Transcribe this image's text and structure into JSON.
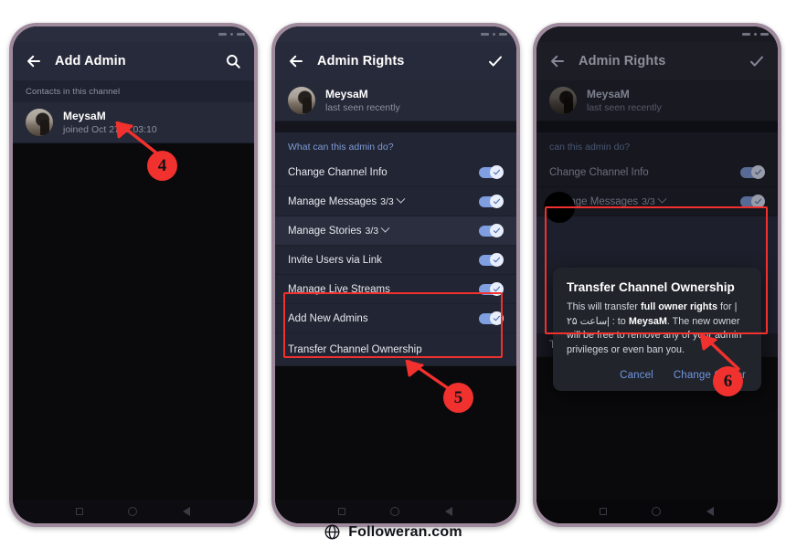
{
  "watermark": {
    "text": "Followeran.com",
    "icon": "globe-icon"
  },
  "colors": {
    "accent_red": "#f1312e",
    "toggle_on": "#7f9fe0",
    "link_blue": "#6f96e0",
    "section_blue": "#7f9cd8",
    "appbar_bg": "#272a3a",
    "list_bg": "#222533"
  },
  "phone1": {
    "appbar": {
      "back": "back-arrow-icon",
      "title": "Add Admin",
      "search": "search-icon"
    },
    "section_header": "Contacts in this channel",
    "contact": {
      "name": "MeysaM",
      "subtitle": "joined Oct 27 at 03:10"
    },
    "navbar": [
      "square-nav-icon",
      "circle-nav-icon",
      "triangle-nav-icon"
    ]
  },
  "phone2": {
    "appbar": {
      "back": "back-arrow-icon",
      "title": "Admin Rights",
      "confirm": "check-icon"
    },
    "contact": {
      "name": "MeysaM",
      "subtitle": "last seen recently"
    },
    "question": "What can this admin do?",
    "rows": [
      {
        "label": "Change Channel Info",
        "count": "",
        "chevron": false,
        "toggle": true,
        "highlight": false
      },
      {
        "label": "Manage Messages",
        "count": "3/3",
        "chevron": true,
        "toggle": true,
        "highlight": false
      },
      {
        "label": "Manage Stories",
        "count": "3/3",
        "chevron": true,
        "toggle": true,
        "highlight": true
      },
      {
        "label": "Invite Users via Link",
        "count": "",
        "chevron": false,
        "toggle": true,
        "highlight": false
      },
      {
        "label": "Manage Live Streams",
        "count": "",
        "chevron": false,
        "toggle": true,
        "highlight": false
      },
      {
        "label": "Add New Admins",
        "count": "",
        "chevron": false,
        "toggle": true,
        "highlight": false
      },
      {
        "label": "Transfer Channel Ownership",
        "count": "",
        "chevron": false,
        "toggle": false,
        "highlight": false
      }
    ],
    "navbar": [
      "square-nav-icon",
      "circle-nav-icon",
      "triangle-nav-icon"
    ]
  },
  "phone3": {
    "appbar": {
      "back": "back-arrow-icon",
      "title": "Admin Rights",
      "confirm": "check-icon"
    },
    "contact": {
      "name": "MeysaM",
      "subtitle": "last seen recently"
    },
    "question": "can this admin do?",
    "rows": [
      {
        "label": "Change Channel Info",
        "count": "",
        "chevron": false,
        "toggle": true
      },
      {
        "label": "Manage Messages",
        "count": "3/3",
        "chevron": true,
        "toggle": true
      }
    ],
    "bottom_row": "Transfer Channel Ownership",
    "dialog": {
      "title": "Transfer Channel Ownership",
      "body_part1": "This will transfer ",
      "body_bold1": "full owner rights",
      "body_part2": " for | ",
      "body_persian": "۲۵ ساعت| :",
      "body_part3": " to ",
      "body_bold2": "MeysaM",
      "body_part4": ". The new owner will be free to remove any of your admin privileges or even ban you.",
      "cancel_label": "Cancel",
      "confirm_label": "Change Owner"
    },
    "navbar": [
      "square-nav-icon",
      "circle-nav-icon",
      "triangle-nav-icon"
    ]
  },
  "annotations": [
    {
      "badge": "4"
    },
    {
      "badge": "5"
    },
    {
      "badge": "6"
    }
  ]
}
